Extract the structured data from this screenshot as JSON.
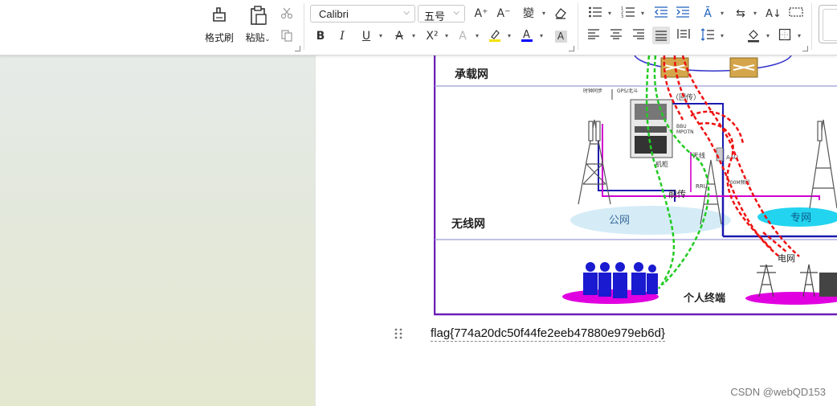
{
  "ribbon": {
    "format_painter_label": "格式刷",
    "paste_label": "粘贴",
    "font_name": "Calibri",
    "font_size": "五号",
    "clear_format_hint": "清除格式",
    "accent_colors": {
      "highlight": "#f5e000",
      "font_color": "#0000ff"
    }
  },
  "figure": {
    "layer_carrier": "承载网",
    "layer_wireless": "无线网",
    "label_backhaul": "（回传）",
    "label_fronthaul": "前传",
    "label_public_net": "公网",
    "label_private_net": "专网",
    "label_grid": "电网",
    "label_terminal": "个人终端",
    "label_cabinet": "机柜",
    "label_antenna": "天线",
    "label_aau": "AAU",
    "label_rru": "RRU",
    "label_bbu": "BBU",
    "label_mpotn": "MPOTN",
    "label_gps": "GPS/北斗",
    "label_clock": "时钟同步",
    "label_700m": "700M频段"
  },
  "document": {
    "flag_text": "flag{774a20dc50f44fe2eeb47880e979eb6d}"
  },
  "watermark": "CSDN @webQD153"
}
